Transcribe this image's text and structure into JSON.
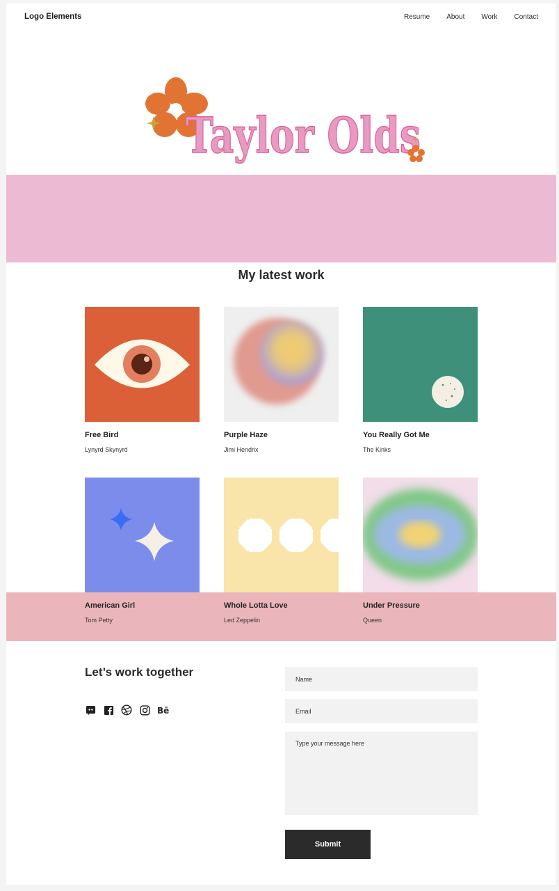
{
  "header": {
    "logo_text": "Logo Elements",
    "nav": [
      "Resume",
      "About",
      "Work",
      "Contact"
    ]
  },
  "hero": {
    "wordmark": "Taylor Olds",
    "colors": {
      "wordmark": "#e89ac0",
      "flower": "#e27433",
      "band": "#ecbbd3"
    }
  },
  "work": {
    "title": "My latest work",
    "items": [
      {
        "title": "Free Bird",
        "artist": "Lynyrd Skynyrd"
      },
      {
        "title": "Purple Haze",
        "artist": "Jimi Hendrix"
      },
      {
        "title": "You Really Got Me",
        "artist": "The Kinks"
      },
      {
        "title": "American Girl",
        "artist": "Tom Petty"
      },
      {
        "title": "Whole Lotta Love",
        "artist": "Led Zeppelin"
      },
      {
        "title": "Under Pressure",
        "artist": "Queen"
      }
    ]
  },
  "contact": {
    "title": "Let’s work together",
    "socials": [
      "discord-icon",
      "facebook-icon",
      "dribbble-icon",
      "instagram-icon",
      "behance-icon"
    ],
    "name_placeholder": "Name",
    "email_placeholder": "Email",
    "message_placeholder": "Type your message here",
    "submit_label": "Submit"
  }
}
